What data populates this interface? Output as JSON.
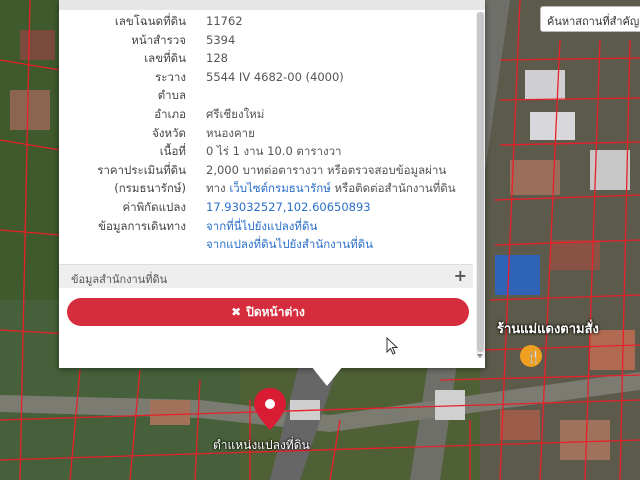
{
  "map": {
    "search_placeholder": "ค้นหาสถานที่สำคัญ",
    "marker_label": "ตำแหน่งแปลงที่ดิน",
    "poi_label": "ร้านแม่แดงตามสั่ง",
    "marker_color": "#d91c34",
    "poi_color": "#f0a020"
  },
  "popup": {
    "fields": [
      {
        "label": "เลขโฉนดที่ดิน",
        "value": "11762"
      },
      {
        "label": "หน้าสำรวจ",
        "value": "5394"
      },
      {
        "label": "เลขที่ดิน",
        "value": "128"
      },
      {
        "label": "ระวาง",
        "value": "5544 IV 4682-00 (4000)"
      },
      {
        "label": "ตำบล",
        "value": ""
      },
      {
        "label": "อำเภอ",
        "value": "ศรีเชียงใหม่"
      },
      {
        "label": "จังหวัด",
        "value": "หนองคาย"
      },
      {
        "label": "เนื้อที่",
        "value": "0 ไร่ 1 งาน 10.0 ตารางวา"
      }
    ],
    "appraisal": {
      "label1": "ราคาประเมินที่ดิน",
      "label2": "(กรมธนารักษ์)",
      "line1": "2,000 บาทต่อตารางวา หรือตรวจสอบข้อมูลผ่าน",
      "line2_prefix": "ทาง ",
      "line2_link": "เว็บไซต์กรมธนารักษ์",
      "line2_suffix": " หรือติดต่อสำนักงานที่ดิน"
    },
    "coords": {
      "label": "ค่าพิกัดแปลง",
      "value": "17.93032527,102.60650893"
    },
    "directions": {
      "label": "ข้อมูลการเดินทาง",
      "link1": "จากที่นี่ไปยังแปลงที่ดิน",
      "link2": "จากแปลงที่ดินไปยังสำนักงานที่ดิน"
    },
    "office_section": {
      "title": "ข้อมูลสำนักงานที่ดิน",
      "toggle": "+"
    },
    "close_button": {
      "icon": "✖",
      "label": "ปิดหน้าต่าง"
    },
    "accent_color": "#d62d3e",
    "link_color": "#2a6fc9"
  }
}
